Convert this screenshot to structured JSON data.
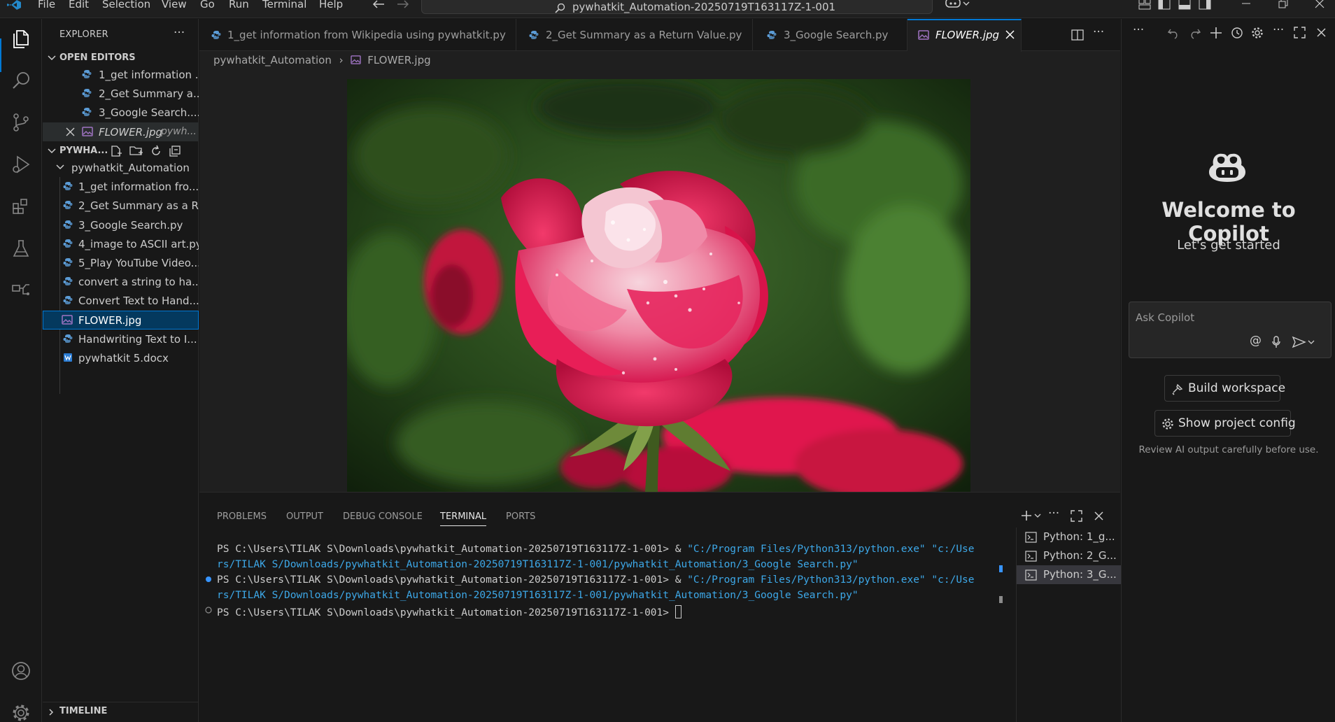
{
  "titlebar": {
    "menu": [
      "File",
      "Edit",
      "Selection",
      "View",
      "Go",
      "Run",
      "Terminal",
      "Help"
    ],
    "command_center": "pywhatkit_Automation-20250719T163117Z-1-001"
  },
  "sidebar": {
    "header": "EXPLORER",
    "open_editors_title": "OPEN EDITORS",
    "open_editors": [
      {
        "label": "1_get information ..."
      },
      {
        "label": "2_Get Summary a..."
      },
      {
        "label": "3_Google Search...."
      },
      {
        "label": "FLOWER.jpg",
        "desc": "pywh..."
      }
    ],
    "workspace_title": "PYWHA...",
    "folder_name": "pywhatkit_Automation",
    "files": [
      {
        "label": "1_get information fro...",
        "icon": "python-file-icon"
      },
      {
        "label": "2_Get Summary as a R...",
        "icon": "python-file-icon"
      },
      {
        "label": "3_Google Search.py",
        "icon": "python-file-icon"
      },
      {
        "label": "4_image to ASCII art.py",
        "icon": "python-file-icon"
      },
      {
        "label": "5_Play YouTube Video...",
        "icon": "python-file-icon"
      },
      {
        "label": "convert a string to ha...",
        "icon": "python-file-icon"
      },
      {
        "label": "Convert Text to Hand...",
        "icon": "python-file-icon"
      },
      {
        "label": "FLOWER.jpg",
        "icon": "image-file-icon"
      },
      {
        "label": "Handwriting Text to I...",
        "icon": "python-file-icon"
      },
      {
        "label": "pywhatkit 5.docx",
        "icon": "word-file-icon"
      }
    ],
    "timeline_title": "TIMELINE"
  },
  "editor": {
    "tabs": [
      {
        "label": "1_get information from Wikipedia using pywhatkit.py"
      },
      {
        "label": "2_Get Summary as a Return Value.py"
      },
      {
        "label": "3_Google Search.py"
      },
      {
        "label": "FLOWER.jpg"
      }
    ],
    "breadcrumb": {
      "folder": "pywhatkit_Automation",
      "file": "FLOWER.jpg"
    }
  },
  "panel": {
    "tabs": [
      "PROBLEMS",
      "OUTPUT",
      "DEBUG CONSOLE",
      "TERMINAL",
      "PORTS"
    ],
    "active_tab": "TERMINAL",
    "terminal": {
      "prompt1": "PS C:\\Users\\TILAK S\\Downloads\\pywhatkit_Automation-20250719T163117Z-1-001> ",
      "amp": "& ",
      "python_path": "\"C:/Program Files/Python313/python.exe\"",
      "script_start": " \"c:/Use",
      "script_rest": "rs/TILAK S/Downloads/pywhatkit_Automation-20250719T163117Z-1-001/pywhatkit_Automation/3_Google Search.py\"",
      "prompt_last": "PS C:\\Users\\TILAK S\\Downloads\\pywhatkit_Automation-20250719T163117Z-1-001> "
    },
    "terminal_list": [
      "Python: 1_g...",
      "Python: 2_G...",
      "Python: 3_G..."
    ]
  },
  "copilot": {
    "title": "Welcome to Copilot",
    "subtitle": "Let's get started",
    "input_placeholder": "Ask Copilot",
    "at_symbol": "@",
    "build_button": "Build workspace",
    "config_button": "Show project config",
    "note": "Review AI output carefully before use."
  },
  "colors": {
    "accent": "#0078d4",
    "python_icon": "#5b9bd5",
    "image_icon": "#a074c4",
    "terminal_string": "#3da8e8"
  }
}
